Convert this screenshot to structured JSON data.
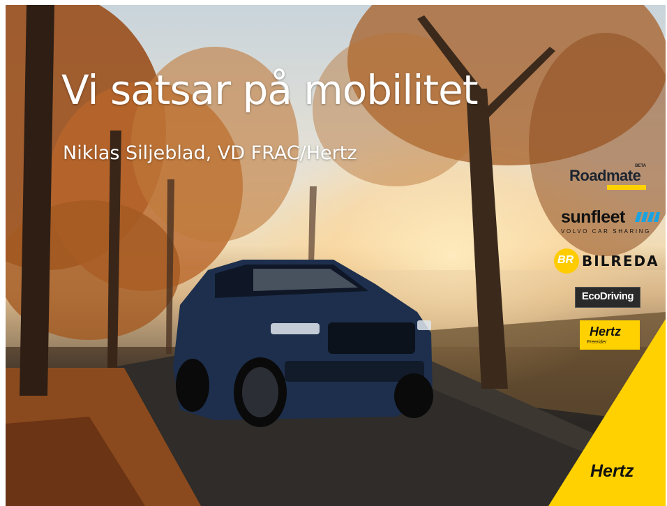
{
  "slide": {
    "title": "Vi satsar på mobilitet",
    "subtitle": "Niklas Siljeblad, VD FRAC/Hertz"
  },
  "logos": {
    "roadmate": {
      "name": "Roadmate",
      "badge": "BETA"
    },
    "sunfleet": {
      "name": "sunfleet",
      "tagline": "VOLVO CAR SHARING"
    },
    "bilreda": {
      "name": "BILREDA",
      "badge": "BR"
    },
    "ecodriving": {
      "name": "EcoDriving"
    },
    "hertz_freerider": {
      "name": "Hertz",
      "sub": "Freerider"
    },
    "hertz": {
      "name": "Hertz"
    }
  },
  "colors": {
    "brand_yellow": "#ffd100",
    "car_blue": "#1d2f4d",
    "foliage": "#b5611f"
  }
}
